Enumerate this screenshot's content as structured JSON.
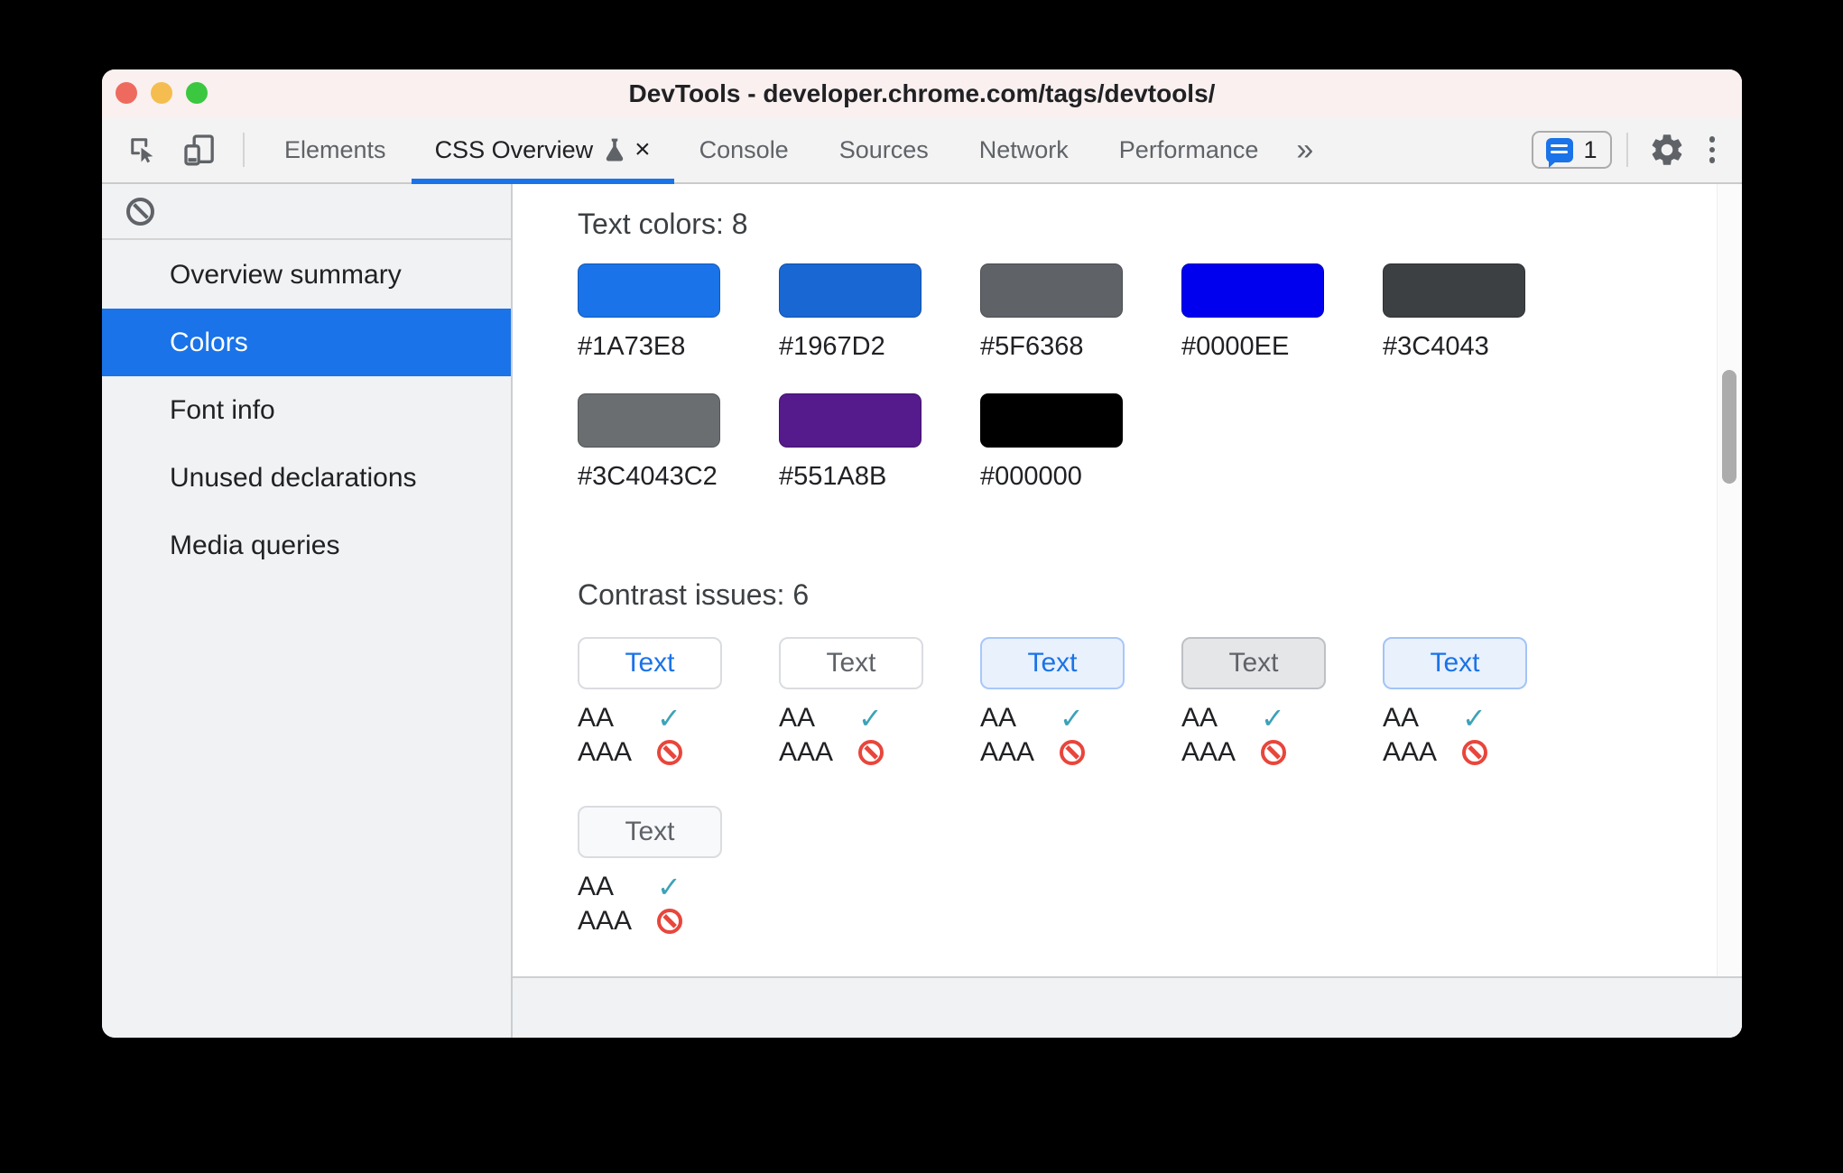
{
  "window": {
    "title": "DevTools - developer.chrome.com/tags/devtools/"
  },
  "toolbar": {
    "tabs": [
      {
        "label": "Elements",
        "active": false
      },
      {
        "label": "CSS Overview",
        "active": true,
        "closable": true
      },
      {
        "label": "Console",
        "active": false
      },
      {
        "label": "Sources",
        "active": false
      },
      {
        "label": "Network",
        "active": false
      },
      {
        "label": "Performance",
        "active": false
      }
    ],
    "more_tabs_label": "»",
    "close_tab_label": "×",
    "messages_count": "1"
  },
  "sidebar": {
    "items": [
      {
        "label": "Overview summary",
        "selected": false
      },
      {
        "label": "Colors",
        "selected": true
      },
      {
        "label": "Font info",
        "selected": false
      },
      {
        "label": "Unused declarations",
        "selected": false
      },
      {
        "label": "Media queries",
        "selected": false
      }
    ]
  },
  "content": {
    "text_colors": {
      "heading": "Text colors: 8",
      "swatches": [
        {
          "hex": "#1A73E8"
        },
        {
          "hex": "#1967D2"
        },
        {
          "hex": "#5F6368"
        },
        {
          "hex": "#0000EE"
        },
        {
          "hex": "#3C4043"
        },
        {
          "hex": "#3C4043C2"
        },
        {
          "hex": "#551A8B"
        },
        {
          "hex": "#000000"
        }
      ]
    },
    "contrast": {
      "heading": "Contrast issues: 6",
      "aa_label": "AA",
      "aaa_label": "AAA",
      "check_glyph": "✓",
      "items": [
        {
          "label": "Text",
          "bg": "#FFFFFF",
          "border": "#DADCE0",
          "text_color": "#1A73E8",
          "aa": "pass",
          "aaa": "fail"
        },
        {
          "label": "Text",
          "bg": "#FFFFFF",
          "border": "#DADCE0",
          "text_color": "#5F6368",
          "aa": "pass",
          "aaa": "fail"
        },
        {
          "label": "Text",
          "bg": "#E9F1FC",
          "border": "#A8C7FA",
          "text_color": "#1A73E8",
          "aa": "pass",
          "aaa": "fail"
        },
        {
          "label": "Text",
          "bg": "#E5E6E8",
          "border": "#BDC1C6",
          "text_color": "#5F6368",
          "aa": "pass",
          "aaa": "fail"
        },
        {
          "label": "Text",
          "bg": "#E9F1FC",
          "border": "#A3C3F7",
          "text_color": "#1A73E8",
          "aa": "pass",
          "aaa": "fail"
        },
        {
          "label": "Text",
          "bg": "#F8F9FA",
          "border": "#DADCE0",
          "text_color": "#5F6368",
          "aa": "pass",
          "aaa": "fail"
        }
      ]
    }
  },
  "ui_colors": {
    "accent": "#1A73E8",
    "titlebar_bg": "#F9F0EF",
    "toolbar_bg": "#F3F3F3",
    "sidebar_bg": "#F1F2F3",
    "selected_item_bg": "#1A73E8",
    "pass_check": "#3DA2B8",
    "fail_icon": "#E8463C",
    "traffic_red": "#EE6A5F",
    "traffic_yellow": "#F5BD4F",
    "traffic_green": "#3BC73F"
  }
}
